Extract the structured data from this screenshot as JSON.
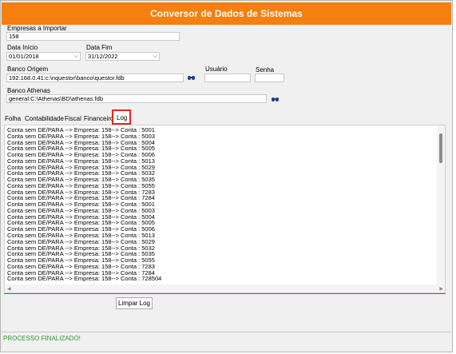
{
  "title": "Conversor de Dados de Sistemas",
  "empresas": {
    "label": "Empresas a Importar",
    "value": "158"
  },
  "data_inicio": {
    "label": "Data Início",
    "value": "01/01/2018"
  },
  "data_fim": {
    "label": "Data Fim",
    "value": "31/12/2022"
  },
  "banco_origem": {
    "label": "Banco Origem",
    "value": "192.168.0.41:c:\\nquestor\\banco\\questor.fdb"
  },
  "usuario": {
    "label": "Usuário",
    "value": ""
  },
  "senha": {
    "label": "Senha",
    "value": ""
  },
  "banco_athenas": {
    "label": "Banco Athenas",
    "value": "general:C:\\Athenas\\BD\\athenas.fdb"
  },
  "tabs": [
    "Folha",
    "Contabilidade",
    "Fiscal",
    "Financeiro",
    "Log"
  ],
  "log_lines": [
    "Conta sem DE/PARA --> Empresa: 158--> Conta : 5001",
    "Conta sem DE/PARA --> Empresa: 158--> Conta : 5003",
    "Conta sem DE/PARA --> Empresa: 158--> Conta : 5004",
    "Conta sem DE/PARA --> Empresa: 158--> Conta : 5005",
    "Conta sem DE/PARA --> Empresa: 158--> Conta : 5006",
    "Conta sem DE/PARA --> Empresa: 158--> Conta : 5013",
    "Conta sem DE/PARA --> Empresa: 158--> Conta : 5029",
    "Conta sem DE/PARA --> Empresa: 158--> Conta : 5032",
    "Conta sem DE/PARA --> Empresa: 158--> Conta : 5035",
    "Conta sem DE/PARA --> Empresa: 158--> Conta : 5055",
    "Conta sem DE/PARA --> Empresa: 158--> Conta : 7283",
    "Conta sem DE/PARA --> Empresa: 158--> Conta : 7284",
    "Conta sem DE/PARA --> Empresa: 158--> Conta : 5001",
    "Conta sem DE/PARA --> Empresa: 158--> Conta : 5003",
    "Conta sem DE/PARA --> Empresa: 158--> Conta : 5004",
    "Conta sem DE/PARA --> Empresa: 158--> Conta : 5005",
    "Conta sem DE/PARA --> Empresa: 158--> Conta : 5006",
    "Conta sem DE/PARA --> Empresa: 158--> Conta : 5013",
    "Conta sem DE/PARA --> Empresa: 158--> Conta : 5029",
    "Conta sem DE/PARA --> Empresa: 158--> Conta : 5032",
    "Conta sem DE/PARA --> Empresa: 158--> Conta : 5035",
    "Conta sem DE/PARA --> Empresa: 158--> Conta : 5055",
    "Conta sem DE/PARA --> Empresa: 158--> Conta : 7283",
    "Conta sem DE/PARA --> Empresa: 158--> Conta : 7284",
    "Conta sem DE/PARA --> Empresa: 158--> Conta : 728504"
  ],
  "clear_button": "Limpar Log",
  "status": "PROCESSO FINALIZADO!",
  "colors": {
    "header": "#f57f0f",
    "status": "#2e9a32",
    "highlight": "#e3261f"
  },
  "icons": [
    "binoculars-icon",
    "chevron-down-icon"
  ]
}
